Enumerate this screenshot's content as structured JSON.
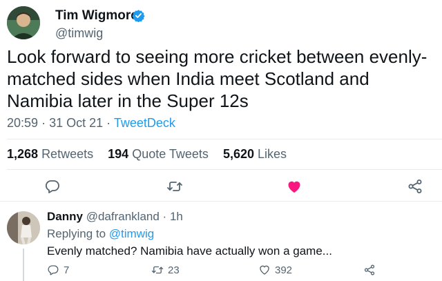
{
  "tweet": {
    "author_name": "Tim Wigmore",
    "author_handle": "@timwig",
    "text": "Look forward to seeing more cricket between evenly-matched sides when India meet Scotland and Namibia later in the Super 12s",
    "time": "20:59",
    "date": "31 Oct 21",
    "source": "TweetDeck",
    "separator": "·",
    "stats": {
      "retweets_count": "1,268",
      "retweets_label": "Retweets",
      "quotes_count": "194",
      "quotes_label": "Quote Tweets",
      "likes_count": "5,620",
      "likes_label": "Likes"
    },
    "liked": true
  },
  "reply": {
    "name": "Danny",
    "handle": "@dafrankland",
    "separator": "·",
    "age": "1h",
    "replying_prefix": "Replying to",
    "replying_to": "@timwig",
    "text": "Evenly matched? Namibia have actually won a game...",
    "reply_count": "7",
    "retweet_count": "23",
    "like_count": "392"
  },
  "colors": {
    "accent": "#1d9bf0",
    "like": "#f91880",
    "muted": "#536471",
    "text": "#0f1419"
  },
  "icons": [
    "verified-badge-icon",
    "reply-icon",
    "retweet-icon",
    "like-icon",
    "share-icon"
  ]
}
